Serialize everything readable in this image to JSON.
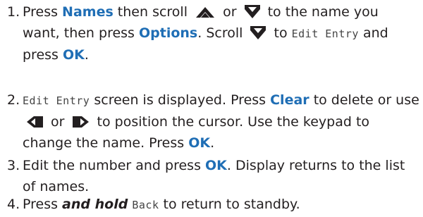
{
  "steps": [
    {
      "number": "1.",
      "p1": "Press ",
      "kw1": "Names",
      "p2": " then scroll ",
      "icon1": "scroll-up-icon",
      "p3": " or ",
      "icon2": "scroll-down-icon",
      "p4": " to the name you want, then press ",
      "kw2": "Options",
      "p5": ". Scroll ",
      "icon3": "scroll-down-icon",
      "p6": " to ",
      "lcd1": "Edit Entry",
      "p7": " and press ",
      "kw3": "OK",
      "p8": "."
    },
    {
      "number": "2.",
      "lcd1": "Edit Entry",
      "p1": " screen is displayed. Press ",
      "kw1": "Clear",
      "p2": " to delete or use ",
      "icon1": "cursor-left-icon",
      "p3": " or ",
      "icon2": "cursor-right-icon",
      "p4": " to position the cursor. Use the keypad to change the name. Press ",
      "kw2": "OK",
      "p5": "."
    },
    {
      "number": "3.",
      "p1": "Edit the number and press ",
      "kw1": "OK",
      "p2": ". Display returns to the list of names."
    },
    {
      "number": "4.",
      "p1": "Press ",
      "emph1": "and hold",
      "p2": " ",
      "lcd1": "Back",
      "p3": " to return to standby."
    }
  ],
  "colors": {
    "keyword": "#1f6eb5",
    "text": "#231f20",
    "icon": "#231f20"
  }
}
